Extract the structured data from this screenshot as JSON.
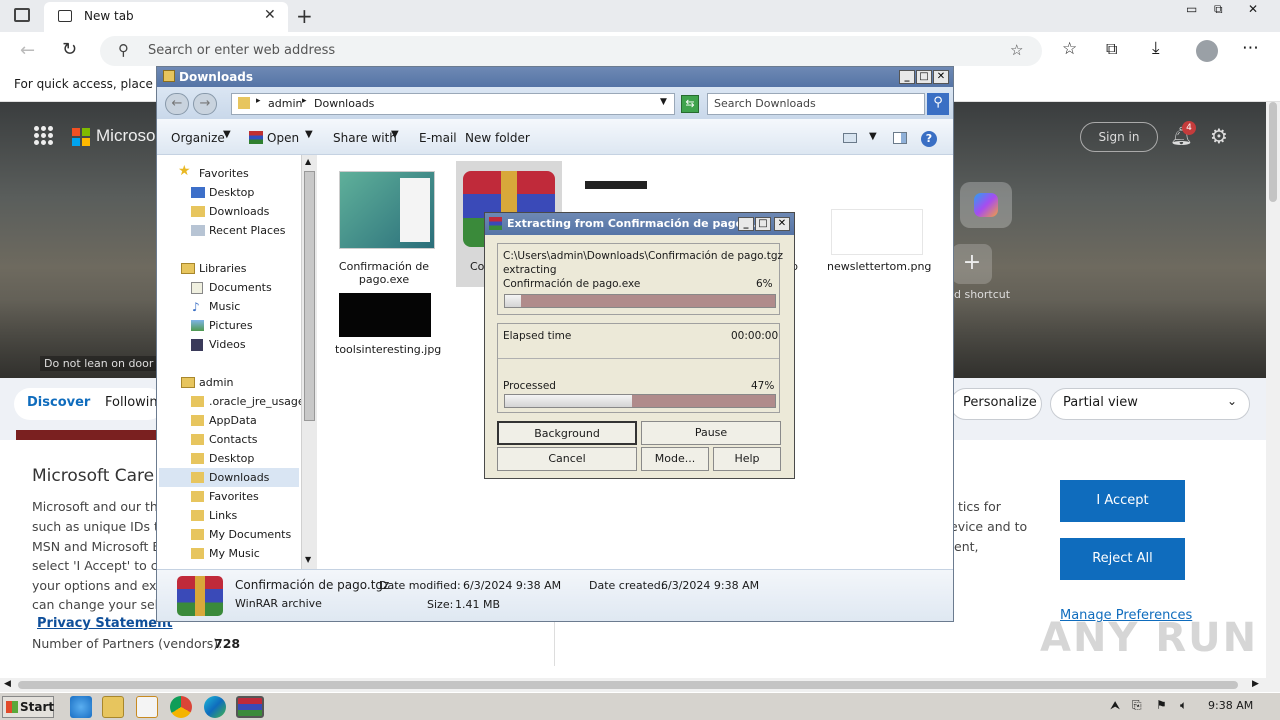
{
  "browser": {
    "tab_title": "New tab",
    "address_placeholder": "Search or enter web address",
    "favorites_hint": "For quick access, place you"
  },
  "msn": {
    "brand": "Microso",
    "sign_in": "Sign in",
    "notif_count": "4",
    "add_shortcut": "d shortcut",
    "subway_sign": "Do not lean on door",
    "tabs": [
      "Discover",
      "Followin"
    ],
    "personalize": "Personalize",
    "view_select": "Partial view"
  },
  "consent": {
    "title": "Microsoft Care",
    "lines": [
      "Microsoft and our thi",
      "such as unique IDs to",
      "MSN and Microsoft E",
      "select 'I Accept' to co",
      "your options and exe",
      "can change your sele"
    ],
    "right_lines": [
      "tics for",
      "evice and to",
      "ent,"
    ],
    "privacy_link": "Privacy Statement",
    "partners_label": "Number of Partners (vendors):",
    "partners_value": "728",
    "accept": "I Accept",
    "reject": "Reject All",
    "manage": "Manage Preferences"
  },
  "explorer": {
    "title": "Downloads",
    "breadcrumb": [
      "admin",
      "Downloads"
    ],
    "search_placeholder": "Search Downloads",
    "toolbar": {
      "organize": "Organize",
      "open": "Open",
      "share": "Share with",
      "email": "E-mail",
      "newfolder": "New folder"
    },
    "nav": {
      "favorites_header": "Favorites",
      "favorites": [
        "Desktop",
        "Downloads",
        "Recent Places"
      ],
      "libraries_header": "Libraries",
      "libraries": [
        "Documents",
        "Music",
        "Pictures",
        "Videos"
      ],
      "user_header": "admin",
      "user": [
        ".oracle_jre_usage",
        "AppData",
        "Contacts",
        "Desktop",
        "Downloads",
        "Favorites",
        "Links",
        "My Documents",
        "My Music"
      ]
    },
    "files": [
      {
        "name": "Confirmación de pago.exe"
      },
      {
        "name": "Cor"
      },
      {
        "name": "p"
      },
      {
        "name": "newslettertom.png"
      },
      {
        "name": "toolsinteresting.jpg"
      }
    ],
    "details": {
      "name": "Confirmación de pago.tgz",
      "type": "WinRAR archive",
      "modified_label": "Date modified:",
      "modified": "6/3/2024 9:38 AM",
      "created_label": "Date created:",
      "created": "6/3/2024 9:38 AM",
      "size_label": "Size:",
      "size": "1.41 MB"
    }
  },
  "rar": {
    "title": "Extracting from Confirmación de pago....",
    "archive_path": "C:\\Users\\admin\\Downloads\\Confirmación de pago.tgz",
    "action": "extracting",
    "file": "Confirmación de pago.exe",
    "file_progress": "6%",
    "file_fraction": 0.06,
    "elapsed_label": "Elapsed time",
    "elapsed": "00:00:00",
    "processed_label": "Processed",
    "processed": "47%",
    "processed_fraction": 0.47,
    "buttons": {
      "background": "Background",
      "pause": "Pause",
      "cancel": "Cancel",
      "mode": "Mode...",
      "help": "Help"
    }
  },
  "taskbar": {
    "start": "Start",
    "clock": "9:38 AM"
  },
  "watermark": "ANY RUN"
}
